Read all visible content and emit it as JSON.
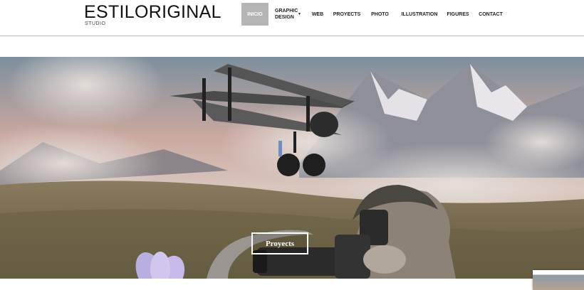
{
  "brand": {
    "title": "ESTILORIGINAL",
    "subtitle": "STUDIO"
  },
  "nav": {
    "active_index": 0,
    "items": [
      {
        "label": "INICIO"
      },
      {
        "label": "GRAPHIC DESIGN",
        "has_dropdown": true
      },
      {
        "label": "WEB"
      },
      {
        "label": "PROYECTS"
      },
      {
        "label": "PHOTO"
      },
      {
        "label": "ILLUSTRATION"
      },
      {
        "label": "FIGURES"
      },
      {
        "label": "CONTACT"
      }
    ]
  },
  "hero": {
    "cta_label": "Proyects",
    "description_icons": [
      "biplane-illustration",
      "mountains",
      "photographer-with-camera",
      "flower"
    ]
  },
  "colors": {
    "active_nav_bg": "#b5b5b5",
    "header_rule": "#bdbdbd",
    "cta_border": "#ffffff"
  }
}
